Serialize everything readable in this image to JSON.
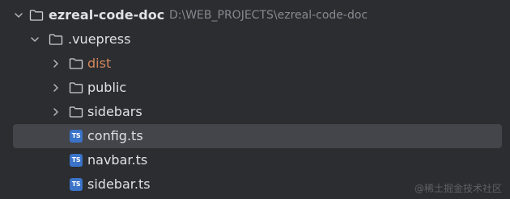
{
  "project": {
    "name": "ezreal-code-doc",
    "path": "D:\\WEB_PROJECTS\\ezreal-code-doc"
  },
  "tree": {
    "vuepress": ".vuepress",
    "dist": "dist",
    "public": "public",
    "sidebars": "sidebars",
    "config": "config.ts",
    "navbar": "navbar.ts",
    "sidebar": "sidebar.ts"
  },
  "file_badge": "TS",
  "watermark": "@稀土掘金技术社区",
  "icons": {
    "expanded": "chevron-down-icon",
    "collapsed": "chevron-right-icon",
    "folder": "folder-icon",
    "typescript": "typescript-file-icon"
  },
  "colors": {
    "background": "#2b2d30",
    "selection": "#43454a",
    "text": "#dfe1e5",
    "path": "#868a91",
    "excluded": "#d3885e",
    "ts_badge": "#3a73c8"
  }
}
